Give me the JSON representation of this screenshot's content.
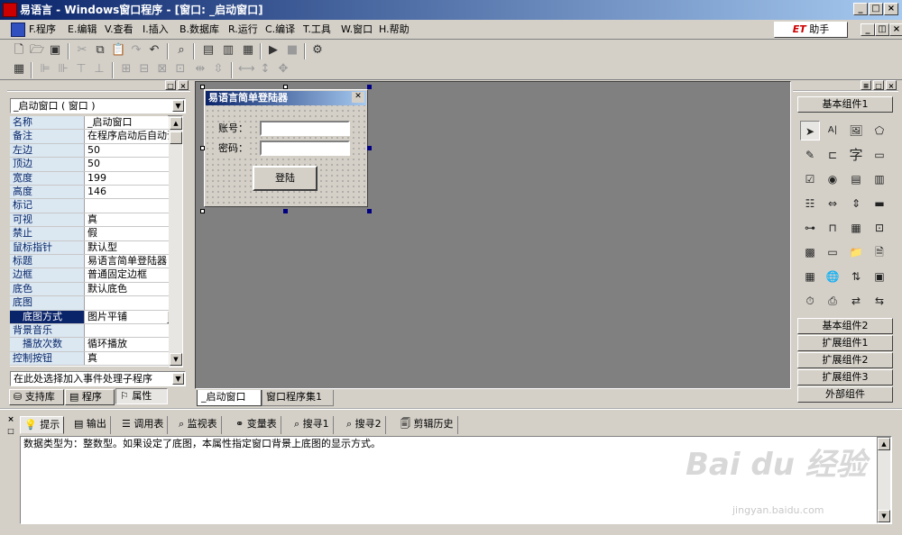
{
  "window": {
    "title": "易语言 - Windows窗口程序 - [窗口: _启动窗口]"
  },
  "menu": [
    "F.程序",
    "E.编辑",
    "V.查看",
    "I.插入",
    "B.数据库",
    "R.运行",
    "C.编译",
    "T.工具",
    "W.窗口",
    "H.帮助"
  ],
  "et_helper": {
    "brand": "ET",
    "label": "助手"
  },
  "left_panel": {
    "object_combo": "_启动窗口 ( 窗口 )",
    "properties": [
      {
        "name": "名称",
        "value": "_启动窗口"
      },
      {
        "name": "备注",
        "value": "在程序启动后自动调"
      },
      {
        "name": "左边",
        "value": "50"
      },
      {
        "name": "顶边",
        "value": "50"
      },
      {
        "name": "宽度",
        "value": "199"
      },
      {
        "name": "高度",
        "value": "146"
      },
      {
        "name": "标记",
        "value": ""
      },
      {
        "name": "可视",
        "value": "真"
      },
      {
        "name": "禁止",
        "value": "假"
      },
      {
        "name": "鼠标指针",
        "value": "默认型"
      },
      {
        "name": "标题",
        "value": "易语言简单登陆器"
      },
      {
        "name": "边框",
        "value": "普通固定边框"
      },
      {
        "name": "底色",
        "value": "默认底色"
      },
      {
        "name": "底图",
        "value": ""
      },
      {
        "name": "底图方式",
        "value": "图片平铺"
      },
      {
        "name": "背景音乐",
        "value": ""
      },
      {
        "name": "播放次数",
        "value": "循环播放"
      },
      {
        "name": "控制按钮",
        "value": "真"
      }
    ],
    "event_combo": "在此处选择加入事件处理子程序",
    "tabs": [
      "支持库",
      "程序",
      "属性"
    ]
  },
  "designer": {
    "dialog_title": "易语言简单登陆器",
    "account_label": "账号：",
    "password_label": "密码：",
    "login_button": "登陆",
    "tabs": [
      "_启动窗口",
      "窗口程序集1"
    ]
  },
  "right_panel": {
    "groups": [
      "基本组件1",
      "基本组件2",
      "扩展组件1",
      "扩展组件2",
      "扩展组件3",
      "外部组件"
    ]
  },
  "bottom_panel": {
    "tabs": [
      "提示",
      "输出",
      "调用表",
      "监视表",
      "变量表",
      "搜寻1",
      "搜寻2",
      "剪辑历史"
    ],
    "message": "数据类型为：整数型。如果设定了底图，本属性指定窗口背景上底图的显示方式。"
  },
  "watermark": {
    "brand": "Bai du 经验",
    "url": "jingyan.baidu.com"
  }
}
